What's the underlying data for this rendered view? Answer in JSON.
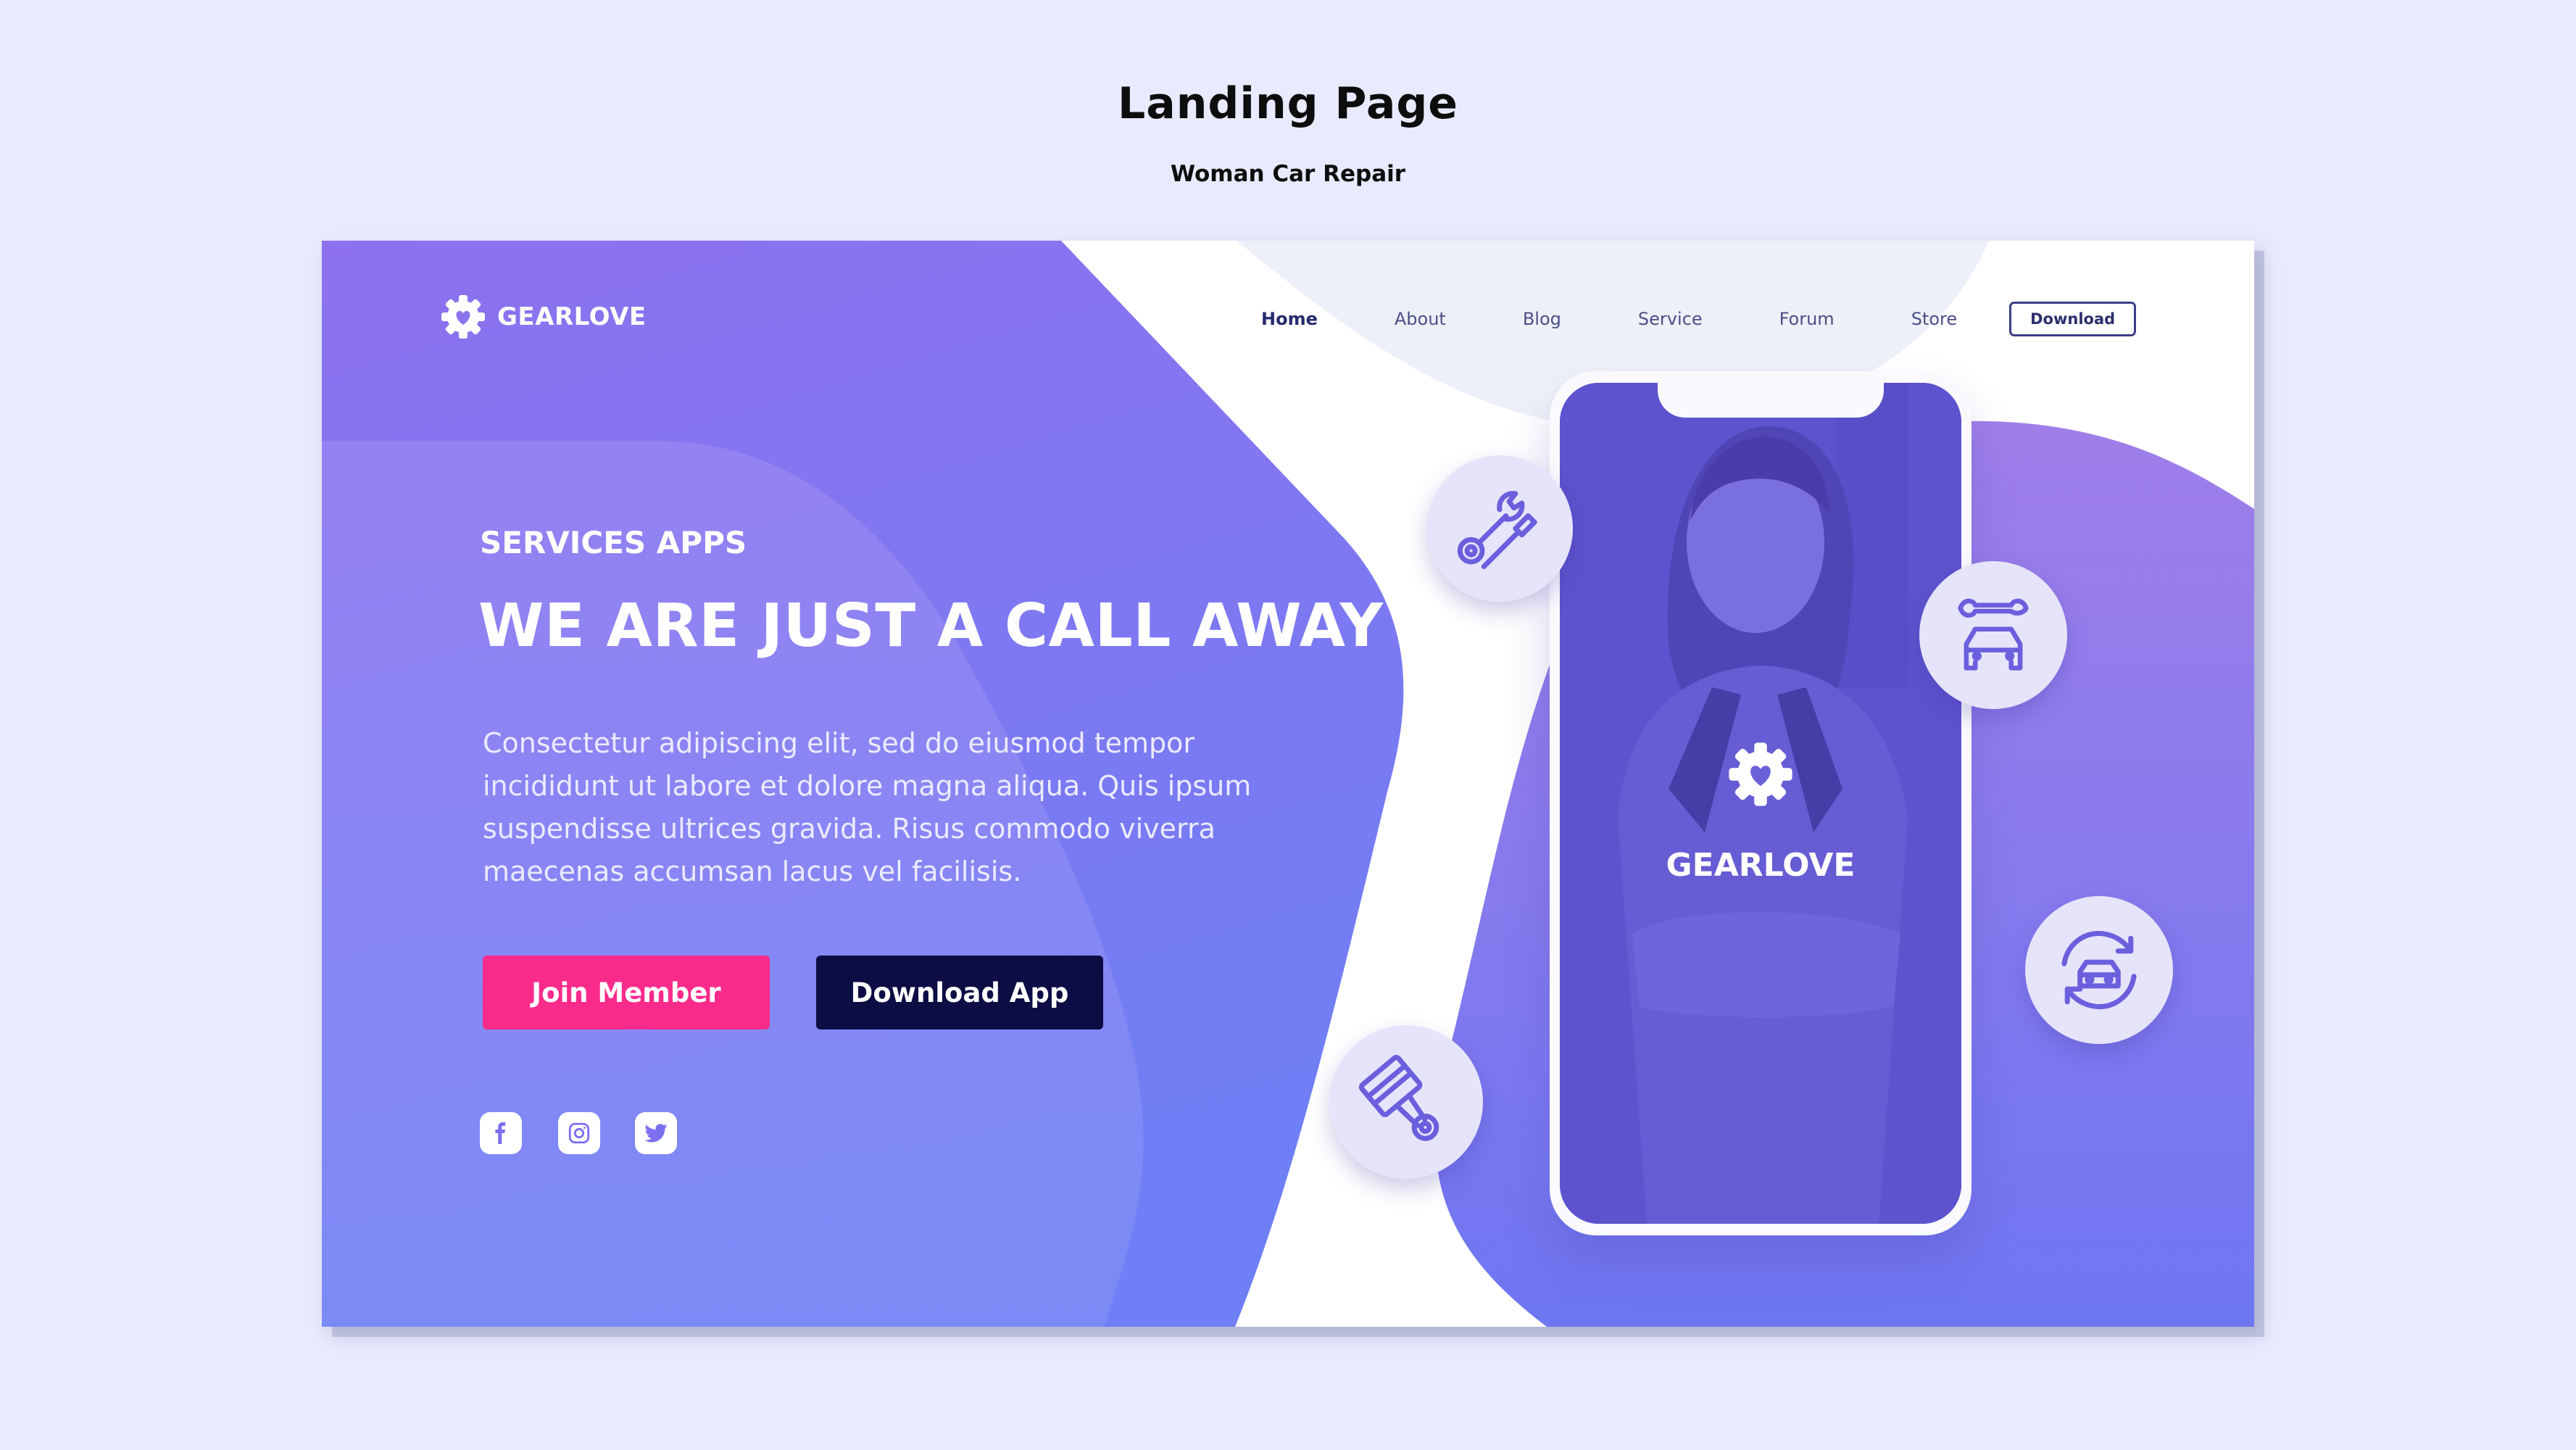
{
  "header": {
    "title": "Landing Page",
    "subtitle": "Woman Car Repair"
  },
  "brand": {
    "name": "GEARLOVE",
    "logo_icon": "gear-heart-icon"
  },
  "nav": {
    "items": [
      {
        "label": "Home",
        "active": true
      },
      {
        "label": "About",
        "active": false
      },
      {
        "label": "Blog",
        "active": false
      },
      {
        "label": "Service",
        "active": false
      },
      {
        "label": "Forum",
        "active": false
      },
      {
        "label": "Store",
        "active": false
      }
    ],
    "download_label": "Download"
  },
  "hero": {
    "eyebrow": "SERVICES APPS",
    "headline": "WE ARE JUST A CALL AWAY",
    "body": "Consectetur adipiscing elit, sed do eiusmod tempor incididunt ut labore et dolore magna aliqua. Quis ipsum suspendisse ultrices gravida. Risus commodo viverra maecenas accumsan lacus vel facilisis.",
    "join_label": "Join Member",
    "download_app_label": "Download App"
  },
  "social": [
    "facebook-icon",
    "instagram-icon",
    "twitter-icon"
  ],
  "phone": {
    "brand": "GEARLOVE"
  },
  "service_icons": [
    "wrench-screwdriver-icon",
    "wrench-car-icon",
    "car-refresh-icon",
    "piston-icon"
  ],
  "colors": {
    "background": "#e8ebfd",
    "primary_purple": "#7f76ee",
    "join_pink": "#fb2b8c",
    "download_navy": "#0d0d45",
    "icon_purple": "#6a5fdd"
  }
}
